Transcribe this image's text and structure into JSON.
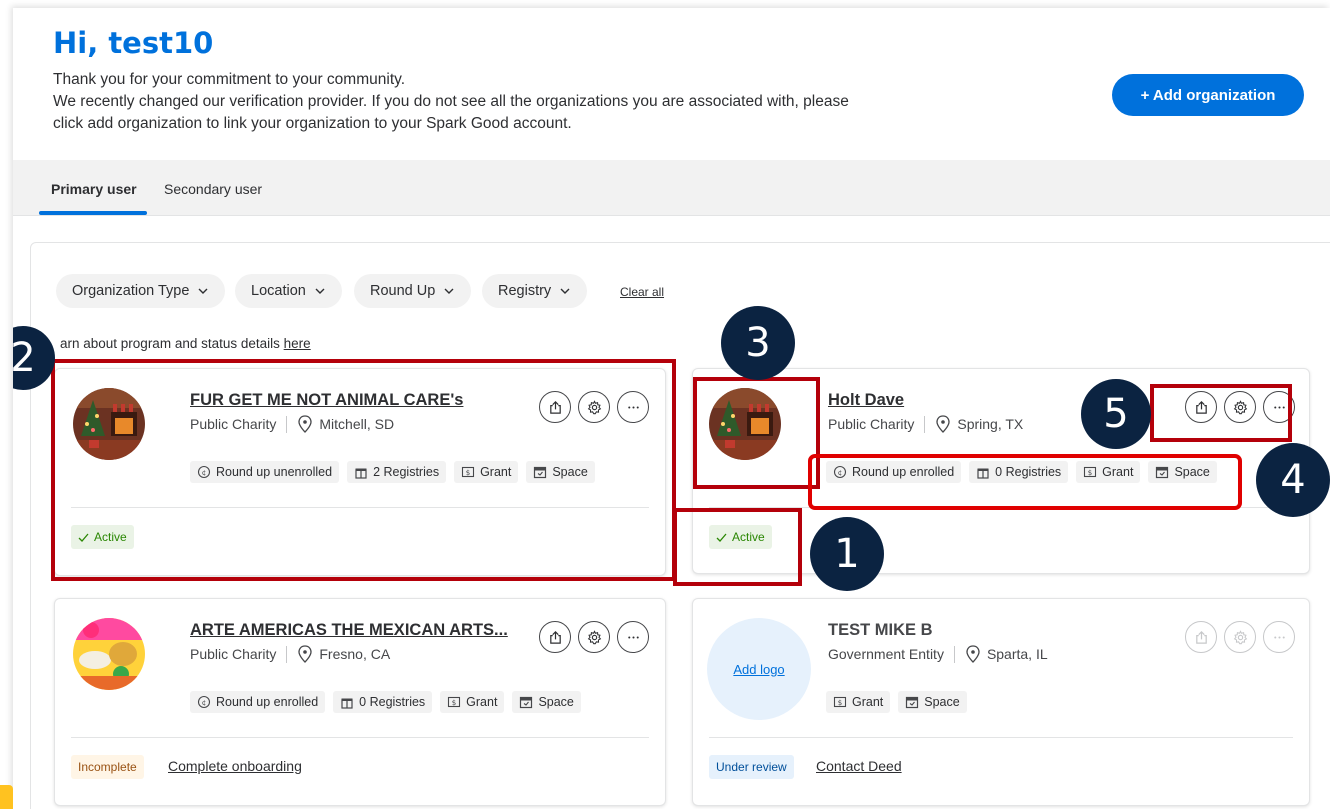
{
  "header": {
    "greeting": "Hi, test10",
    "intro_lines": [
      "Thank you for your commitment to your community.",
      "We recently changed our verification provider. If you do not see all the organizations you are associated with, please",
      "click add organization to link your organization to your Spark Good account."
    ],
    "add_org_label": "+ Add organization"
  },
  "tabs": [
    {
      "label": "Primary user",
      "active": true
    },
    {
      "label": "Secondary user",
      "active": false
    }
  ],
  "filters": {
    "chips": [
      "Organization Type",
      "Location",
      "Round Up",
      "Registry"
    ],
    "clear_all": "Clear all"
  },
  "learn": {
    "text": "arn about program and status details",
    "link": "here"
  },
  "cards": [
    {
      "name": "FUR GET ME NOT ANIMAL CARE's",
      "type": "Public Charity",
      "location": "Mitchell, SD",
      "badges": [
        "Round up unenrolled",
        "2 Registries",
        "Grant",
        "Space"
      ],
      "status": "Active",
      "status_link": ""
    },
    {
      "name": "Holt Dave",
      "type": "Public Charity",
      "location": "Spring, TX",
      "badges": [
        "Round up enrolled",
        "0 Registries",
        "Grant",
        "Space"
      ],
      "status": "Active",
      "status_link": ""
    },
    {
      "name": "ARTE AMERICAS THE MEXICAN ARTS...",
      "type": "Public Charity",
      "location": "Fresno, CA",
      "badges": [
        "Round up enrolled",
        "0 Registries",
        "Grant",
        "Space"
      ],
      "status": "Incomplete",
      "status_link": "Complete onboarding"
    },
    {
      "name": "TEST MIKE B",
      "type": "Government Entity",
      "location": "Sparta, IL",
      "add_logo": "Add logo",
      "badges": [
        "Grant",
        "Space"
      ],
      "status": "Under review",
      "status_link": "Contact Deed"
    }
  ],
  "annotations": [
    "1",
    "2",
    "3",
    "4",
    "5"
  ],
  "colors": {
    "accent": "#0071dc",
    "annotation_box": "#b4000a",
    "annotation_circle": "#0b2341",
    "active_green": "#2a8703"
  }
}
